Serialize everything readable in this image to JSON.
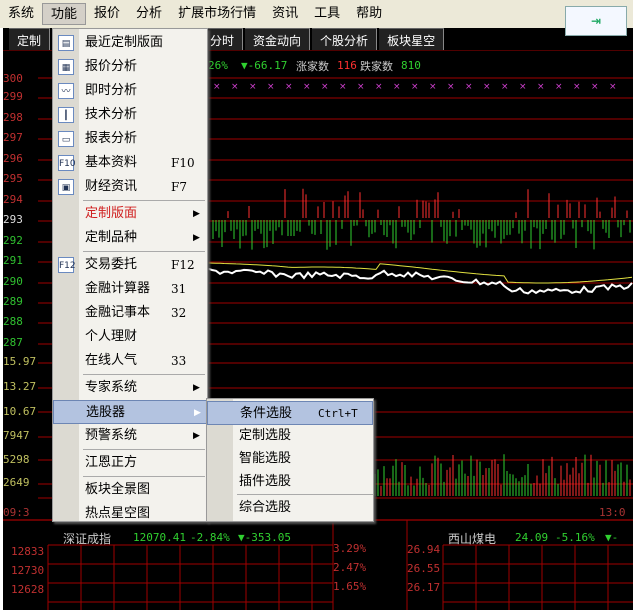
{
  "menubar": [
    "系统",
    "功能",
    "报价",
    "分析",
    "扩展市场行情",
    "资讯",
    "工具",
    "帮助"
  ],
  "pin_icon": "pin-arrow-icon",
  "tabs": [
    "定制",
    "分时",
    "资金动向",
    "个股分析",
    "板块星空"
  ],
  "index_info": {
    "pct": "26%",
    "change": "▼-66.17",
    "up_label": "涨家数",
    "up": "116",
    "down_label": "跌家数",
    "down": "810"
  },
  "left_axis": [
    "300",
    "299",
    "298",
    "297",
    "296",
    "295",
    "294",
    "293",
    "292",
    "291",
    "290",
    "289",
    "288",
    "287",
    "15.97",
    "13.27",
    "10.67",
    "7947",
    "5298",
    "2649",
    "09:3"
  ],
  "time_right": "13:0",
  "bottom_left": {
    "name": "深证成指",
    "value": "12070.41",
    "pct": "-2.84%",
    "change": "▼-353.05",
    "axis": [
      "12833",
      "12730",
      "12628"
    ],
    "pct_axis": [
      "3.29%",
      "2.47%",
      "1.65%"
    ]
  },
  "bottom_right": {
    "name": "西山煤电",
    "value": "24.09",
    "pct": "-5.16%",
    "change": "▼-",
    "axis": [
      "26.94",
      "26.55",
      "26.17"
    ]
  },
  "menu": [
    {
      "label": "最近定制版面",
      "icon": "recent-layout-icon",
      "glyph": "▤"
    },
    {
      "label": "报价分析",
      "icon": "quote-grid-icon",
      "glyph": "▦"
    },
    {
      "label": "即时分析",
      "icon": "line-chart-icon",
      "glyph": "〰"
    },
    {
      "label": "技术分析",
      "icon": "candlestick-icon",
      "glyph": "┃"
    },
    {
      "label": "报表分析",
      "icon": "report-icon",
      "glyph": "▭"
    },
    {
      "label": "基本资料",
      "icon": "f10-icon",
      "glyph": "F10",
      "shortcut": "F10"
    },
    {
      "label": "财经资讯",
      "icon": "news-icon",
      "glyph": "▣",
      "shortcut": "F7"
    },
    {
      "label": "定制版面",
      "submenu": true,
      "red": true
    },
    {
      "label": "定制品种",
      "submenu": true
    },
    {
      "label": "交易委托",
      "icon": "f12-icon",
      "glyph": "F12",
      "shortcut": "F12"
    },
    {
      "label": "金融计算器",
      "shortcut": "31"
    },
    {
      "label": "金融记事本",
      "shortcut": "32"
    },
    {
      "label": "个人理财"
    },
    {
      "label": "在线人气",
      "shortcut": "33"
    },
    {
      "label": "专家系统",
      "submenu": true
    },
    {
      "label": "选股器",
      "submenu": true,
      "highlight": true
    },
    {
      "label": "预警系统",
      "submenu": true
    },
    {
      "label": "江恩正方"
    },
    {
      "label": "板块全景图"
    },
    {
      "label": "热点星空图"
    }
  ],
  "submenu": [
    {
      "label": "条件选股",
      "shortcut": "Ctrl+T",
      "highlight": true
    },
    {
      "label": "定制选股"
    },
    {
      "label": "智能选股"
    },
    {
      "label": "插件选股"
    },
    {
      "label": "综合选股"
    }
  ],
  "colors": {
    "up": "#ff3030",
    "down": "#30d030",
    "grid": "#a00000",
    "price": "#ffffff",
    "avg": "#e0e040",
    "highlight": "#b3c3e0"
  }
}
